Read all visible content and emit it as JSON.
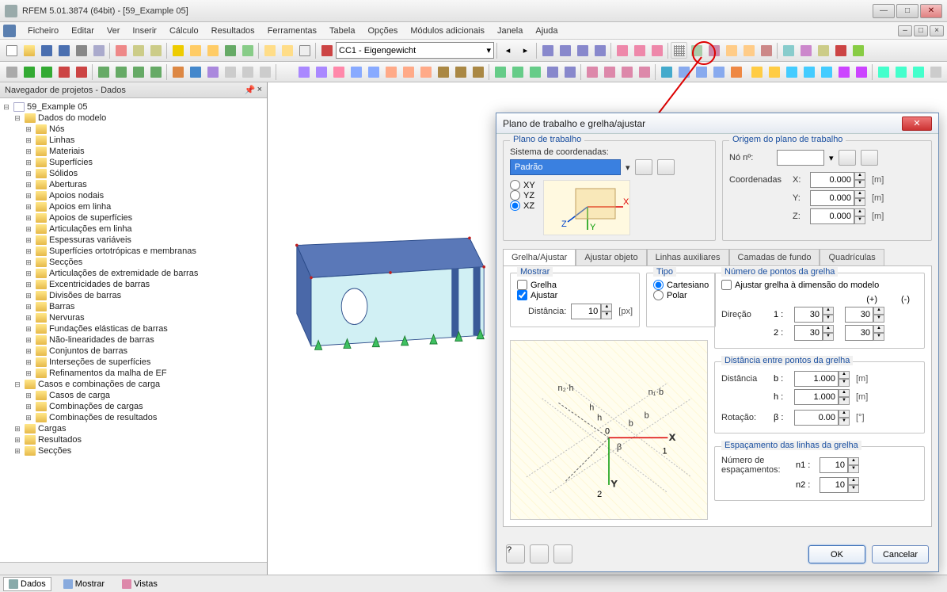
{
  "title": "RFEM 5.01.3874 (64bit) - [59_Example 05]",
  "menu": [
    "Ficheiro",
    "Editar",
    "Ver",
    "Inserir",
    "Cálculo",
    "Resultados",
    "Ferramentas",
    "Tabela",
    "Opções",
    "Módulos adicionais",
    "Janela",
    "Ajuda"
  ],
  "toolbar_combo": "CC1 - Eigengewicht",
  "sidebar": {
    "title": "Navegador de projetos - Dados",
    "root": "59_Example 05",
    "group1": "Dados do modelo",
    "items1": [
      "Nós",
      "Linhas",
      "Materiais",
      "Superfícies",
      "Sólidos",
      "Aberturas",
      "Apoios nodais",
      "Apoios em linha",
      "Apoios de superfícies",
      "Articulações em linha",
      "Espessuras variáveis",
      "Superfícies ortotrópicas e membranas",
      "Secções",
      "Articulações de extremidade de barras",
      "Excentricidades de barras",
      "Divisões de barras",
      "Barras",
      "Nervuras",
      "Fundações elásticas de barras",
      "Não-linearidades de barras",
      "Conjuntos de barras",
      "Interseções de superfícies",
      "Refinamentos da malha de EF"
    ],
    "group2": "Casos e combinações de carga",
    "items2": [
      "Casos de carga",
      "Combinações de cargas",
      "Combinações de resultados"
    ],
    "group3": "Cargas",
    "group4": "Resultados",
    "group5": "Secções"
  },
  "bottom_tabs": [
    "Dados",
    "Mostrar",
    "Vistas"
  ],
  "dialog": {
    "title": "Plano de trabalho e grelha/ajustar",
    "plane_group": "Plano de trabalho",
    "coord_label": "Sistema de coordenadas:",
    "coord_value": "Padrão",
    "planes": {
      "xy": "XY",
      "yz": "YZ",
      "xz": "XZ",
      "selected": "xz"
    },
    "origin_group": "Origem do plano de trabalho",
    "node_label": "Nó nº:",
    "coords_label": "Coordenadas",
    "x_label": "X:",
    "y_label": "Y:",
    "z_label": "Z:",
    "x": "0.000",
    "y": "0.000",
    "z": "0.000",
    "unit_m": "[m]",
    "tabs": [
      "Grelha/Ajustar",
      "Ajustar objeto",
      "Linhas auxiliares",
      "Camadas de fundo",
      "Quadrículas"
    ],
    "show_group": "Mostrar",
    "show_grid": "Grelha",
    "show_snap": "Ajustar",
    "dist_label": "Distância:",
    "dist_value": "10",
    "dist_unit": "[px]",
    "type_group": "Tipo",
    "type_cart": "Cartesiano",
    "type_polar": "Polar",
    "npts_group": "Número de pontos da grelha",
    "fit_model": "Ajustar grelha à dimensão do modelo",
    "dir_label": "Direção",
    "plus": "(+)",
    "minus": "(-)",
    "dir1": "1 :",
    "dir2": "2 :",
    "dir1p": "30",
    "dir1m": "30",
    "dir2p": "30",
    "dir2m": "30",
    "spacing_group": "Distância entre pontos da grelha",
    "dist_b_lbl": "Distância",
    "b_lbl": "b :",
    "h_lbl": "h :",
    "b_val": "1.000",
    "h_val": "1.000",
    "rot_lbl": "Rotação:",
    "beta_lbl": "β :",
    "beta_val": "0.00",
    "deg_unit": "[°]",
    "lines_group": "Espaçamento das linhas da grelha",
    "nlines_lbl": "Número de espaçamentos:",
    "n1_lbl": "n1 :",
    "n2_lbl": "n2 :",
    "n1": "10",
    "n2": "10",
    "ok": "OK",
    "cancel": "Cancelar"
  }
}
